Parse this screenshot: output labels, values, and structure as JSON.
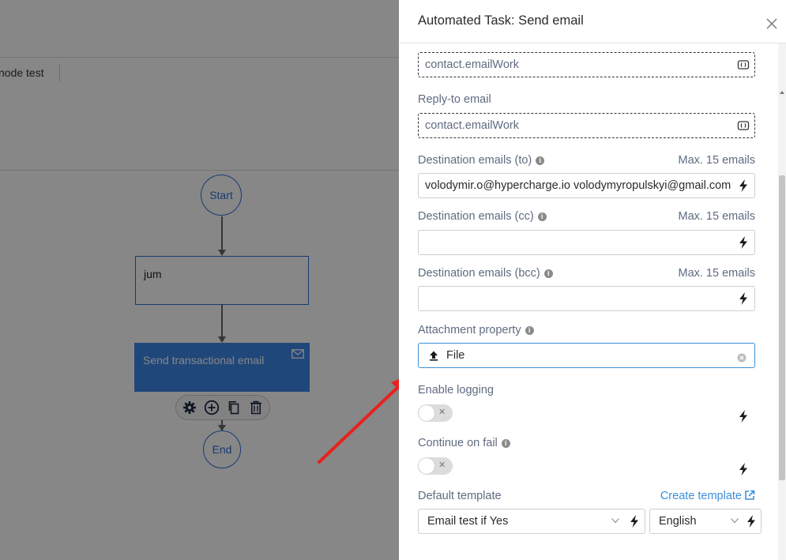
{
  "canvas": {
    "mode_text": "node test",
    "nodes": {
      "start": "Start",
      "step": "jum",
      "email": "Send transactional email",
      "end": "End"
    }
  },
  "panel": {
    "title": "Automated Task: Send email",
    "sender_value": "contact.emailWork",
    "reply_to": {
      "label": "Reply-to email",
      "value": "contact.emailWork"
    },
    "dest_to": {
      "label": "Destination emails (to)",
      "max": "Max. 15 emails",
      "value": "volodymir.o@hypercharge.io volodymyropulskyi@gmail.com"
    },
    "dest_cc": {
      "label": "Destination emails (cc)",
      "max": "Max. 15 emails",
      "value": ""
    },
    "dest_bcc": {
      "label": "Destination emails (bcc)",
      "max": "Max. 15 emails",
      "value": ""
    },
    "attachment": {
      "label": "Attachment property",
      "value": "File"
    },
    "enable_logging": {
      "label": "Enable logging"
    },
    "continue_on_fail": {
      "label": "Continue on fail"
    },
    "default_template": {
      "label": "Default template",
      "create_link": "Create template",
      "template_value": "Email test if Yes",
      "language_value": "English"
    }
  },
  "colors": {
    "accent": "#3d86e6",
    "link": "#3b8fd9",
    "annotation_arrow": "#e8211d"
  }
}
